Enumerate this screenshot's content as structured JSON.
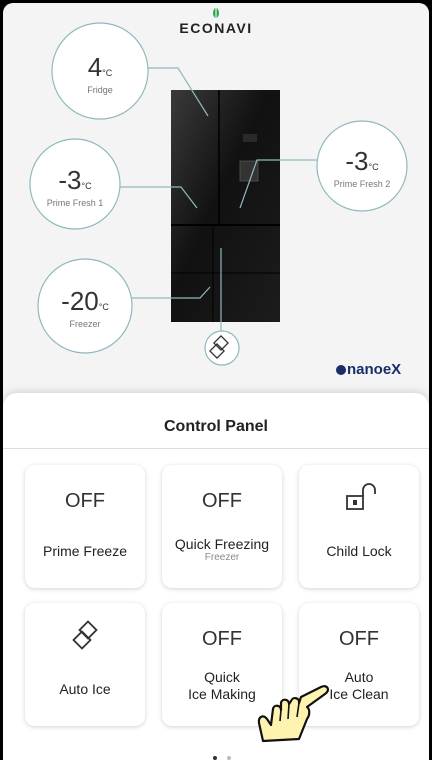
{
  "brand": {
    "econavi": "ECONAVI",
    "nanoe": "nanoeX"
  },
  "zones": {
    "fridge": {
      "value": "4",
      "unit": "°C",
      "label": "Fridge"
    },
    "prime_fresh_1": {
      "value": "-3",
      "unit": "°C",
      "label": "Prime Fresh 1"
    },
    "prime_fresh_2": {
      "value": "-3",
      "unit": "°C",
      "label": "Prime Fresh 2"
    },
    "freezer": {
      "value": "-20",
      "unit": "°C",
      "label": "Freezer"
    }
  },
  "control_panel": {
    "title": "Control Panel",
    "cards": [
      {
        "state": "OFF",
        "label": "Prime Freeze"
      },
      {
        "state": "OFF",
        "label": "Quick Freezing",
        "sublabel": "Freezer"
      },
      {
        "icon": "padlock-open-icon",
        "label": "Child Lock"
      },
      {
        "icon": "ice-cubes-icon",
        "label": "Auto Ice"
      },
      {
        "state": "OFF",
        "label_line1": "Quick",
        "label_line2": "Ice Making"
      },
      {
        "state": "OFF",
        "label_line1": "Auto",
        "label_line2": "Ice Clean"
      }
    ]
  },
  "pagination": {
    "pages": 2,
    "current": 1
  },
  "colors": {
    "accent_teal": "#8fb9bd",
    "dot_active": "#333333",
    "dot_inactive": "#bbbbbb",
    "nanoe_blue": "#1a2d6b",
    "hand_yellow": "#fff3b0"
  }
}
